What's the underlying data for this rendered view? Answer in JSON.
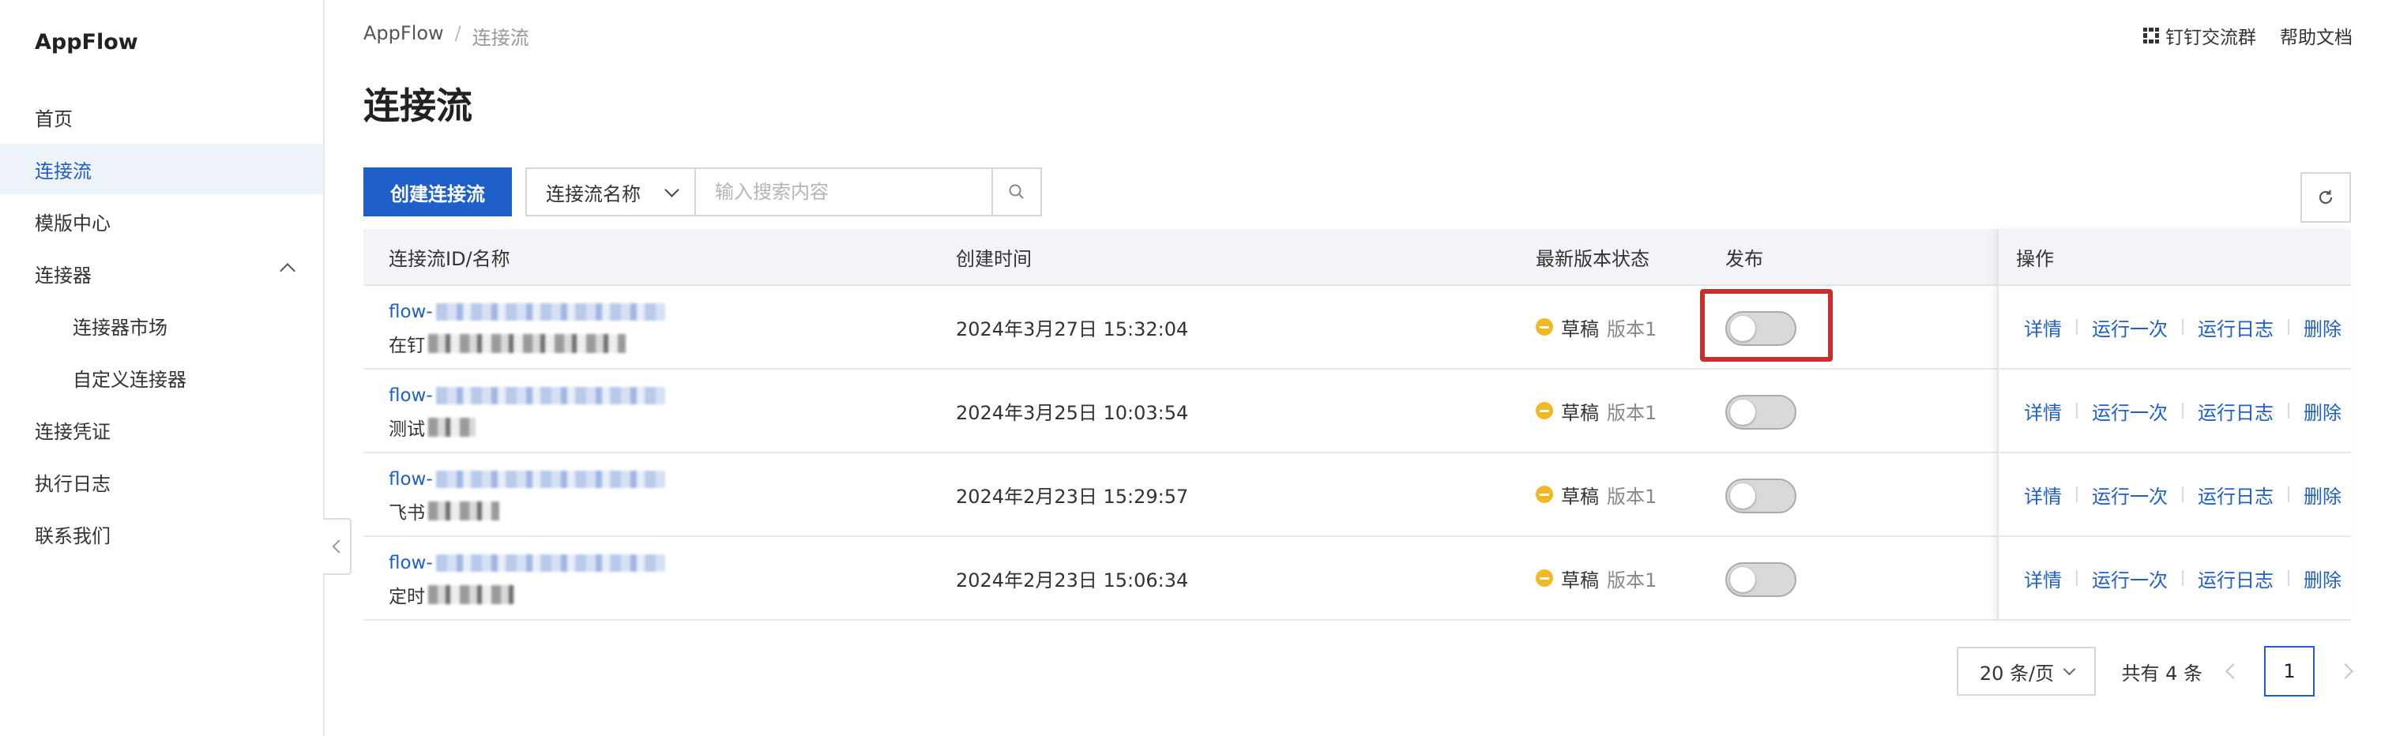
{
  "sidebar": {
    "brand": "AppFlow",
    "items": [
      {
        "label": "首页"
      },
      {
        "label": "连接流"
      },
      {
        "label": "模版中心"
      },
      {
        "label": "连接器"
      },
      {
        "label": "连接器市场"
      },
      {
        "label": "自定义连接器"
      },
      {
        "label": "连接凭证"
      },
      {
        "label": "执行日志"
      },
      {
        "label": "联系我们"
      }
    ]
  },
  "header": {
    "breadcrumb": [
      "AppFlow",
      "/",
      "连接流"
    ],
    "links": [
      "钉钉交流群",
      "帮助文档"
    ],
    "title": "连接流"
  },
  "toolbar": {
    "create_label": "创建连接流",
    "search_field": "连接流名称",
    "search_placeholder": "输入搜索内容"
  },
  "table": {
    "columns": [
      "连接流ID/名称",
      "创建时间",
      "最新版本状态",
      "发布",
      "操作"
    ],
    "rows": [
      {
        "id_prefix": "flow-",
        "name_prefix": "在钉",
        "created": "2024年3月27日 15:32:04",
        "status": "草稿",
        "version": "版本1"
      },
      {
        "id_prefix": "flow-",
        "name_prefix": "测试",
        "created": "2024年3月25日 10:03:54",
        "status": "草稿",
        "version": "版本1"
      },
      {
        "id_prefix": "flow-",
        "name_prefix": "飞书",
        "created": "2024年2月23日 15:29:57",
        "status": "草稿",
        "version": "版本1"
      },
      {
        "id_prefix": "flow-",
        "name_prefix": "定时",
        "created": "2024年2月23日 15:06:34",
        "status": "草稿",
        "version": "版本1"
      }
    ],
    "actions": [
      "详情",
      "运行一次",
      "运行日志",
      "删除"
    ]
  },
  "pagination": {
    "page_size": "20 条/页",
    "total": "共有 4 条",
    "current": "1"
  },
  "colors": {
    "primary": "#1f5fc9",
    "highlight": "#c7302c",
    "draft": "#f2b824"
  }
}
